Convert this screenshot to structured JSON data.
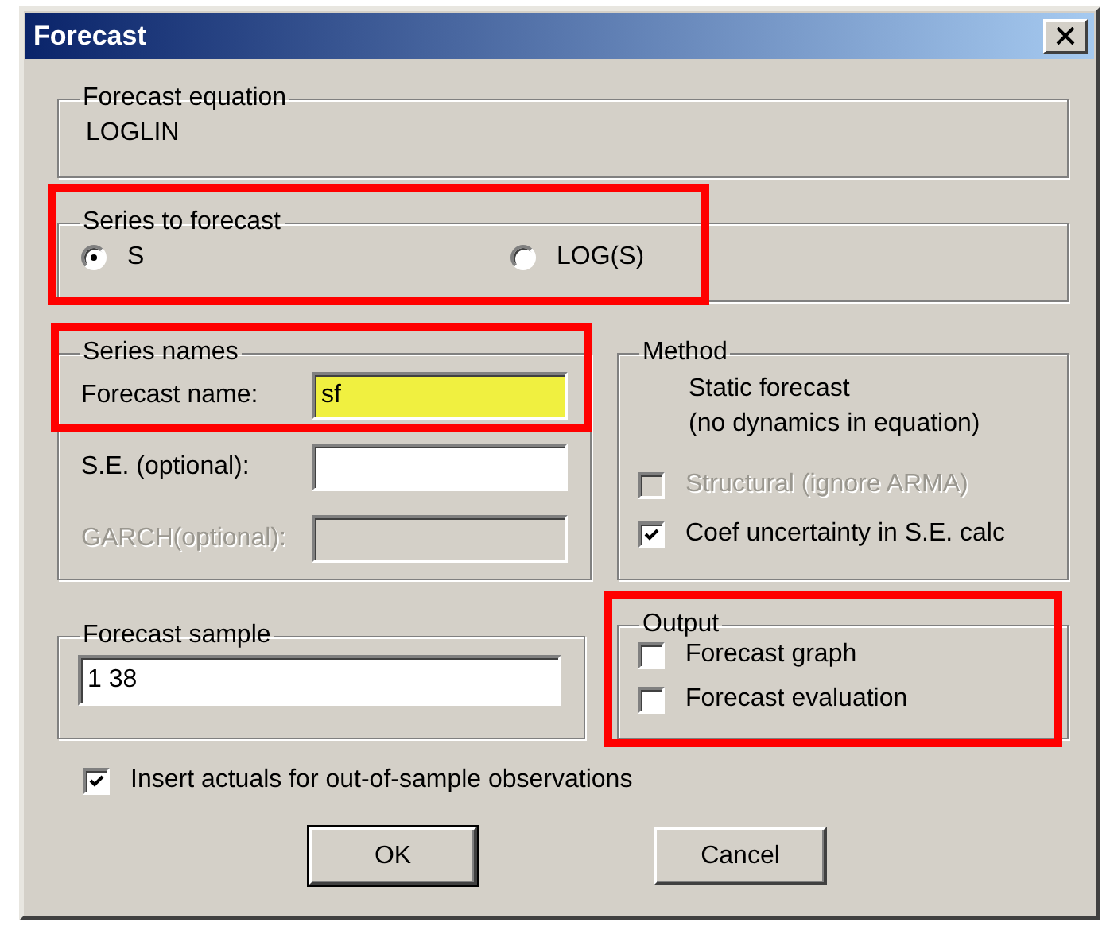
{
  "window": {
    "title": "Forecast"
  },
  "forecast_equation": {
    "label": "Forecast equation",
    "value": "LOGLIN"
  },
  "series_to_forecast": {
    "label": "Series to forecast",
    "highlighted": true,
    "options": [
      {
        "label": "S",
        "selected": true
      },
      {
        "label": "LOG(S)",
        "selected": false
      }
    ]
  },
  "series_names": {
    "label": "Series names",
    "highlighted": true,
    "fields": [
      {
        "label": "Forecast name:",
        "value": "sf",
        "focused": true,
        "disabled": false
      },
      {
        "label": "S.E. (optional):",
        "focused": false,
        "disabled": false
      },
      {
        "label": "GARCH(optional):",
        "focused": false,
        "disabled": true
      }
    ]
  },
  "method": {
    "label": "Method",
    "description": [
      "Static forecast",
      "(no dynamics in equation)"
    ],
    "options": [
      {
        "label": "Structural (ignore ARMA)",
        "checked": false,
        "disabled": true
      },
      {
        "label": "Coef uncertainty in S.E. calc",
        "checked": true,
        "disabled": false
      }
    ]
  },
  "forecast_sample": {
    "label": "Forecast sample",
    "value": "1 38"
  },
  "output": {
    "label": "Output",
    "highlighted": true,
    "options": [
      {
        "label": "Forecast graph",
        "checked": false
      },
      {
        "label": "Forecast evaluation",
        "checked": false
      }
    ]
  },
  "insert_actuals": {
    "label": "Insert actuals for out-of-sample observations",
    "checked": true
  },
  "buttons": [
    {
      "label": "OK",
      "default": true
    },
    {
      "label": "Cancel",
      "default": false
    }
  ]
}
